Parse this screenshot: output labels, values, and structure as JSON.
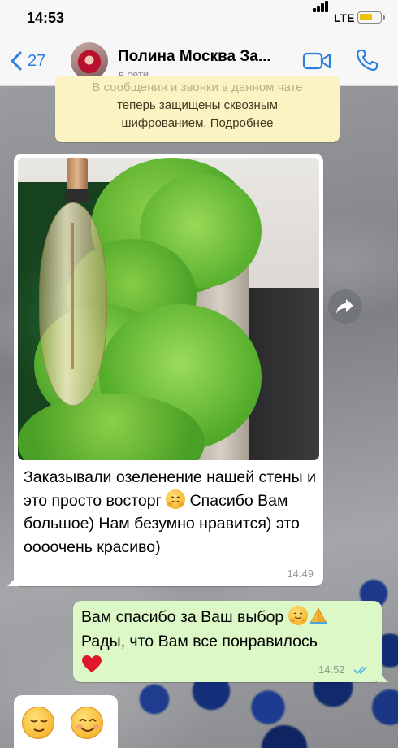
{
  "status_bar": {
    "time": "14:53",
    "network": "LTE",
    "battery_level": 0.65,
    "battery_color": "#f2c200"
  },
  "nav": {
    "back_count": "27",
    "contact_name": "Полина Москва За...",
    "contact_status": "в сети",
    "accent_color": "#2a7fe0"
  },
  "encryption_notice": {
    "line1": "В сообщения и звонки в данном чате",
    "line2": "теперь защищены сквозным",
    "line3": "шифрованием. Подробнее"
  },
  "messages": [
    {
      "direction": "incoming",
      "has_photo": true,
      "text": "Заказывали озеленение нашей стены и это просто восторг",
      "emoji": "hugging-face",
      "text_2": "Спасибо Вам большое) Нам безумно нравится) это оооочень красиво)",
      "time": "14:49"
    },
    {
      "direction": "outgoing",
      "line1": "Вам спасибо за Ваш выбор",
      "line1_emoji": [
        "hugging-face",
        "folded-hands"
      ],
      "line2": "Рады, что Вам все понравилось",
      "line3_emoji": [
        "red-heart"
      ],
      "time": "14:52",
      "status": "read",
      "bubble_color": "#dcf8c6"
    },
    {
      "direction": "incoming",
      "emoji_only": [
        "relieved-face",
        "smiling-face"
      ]
    }
  ]
}
